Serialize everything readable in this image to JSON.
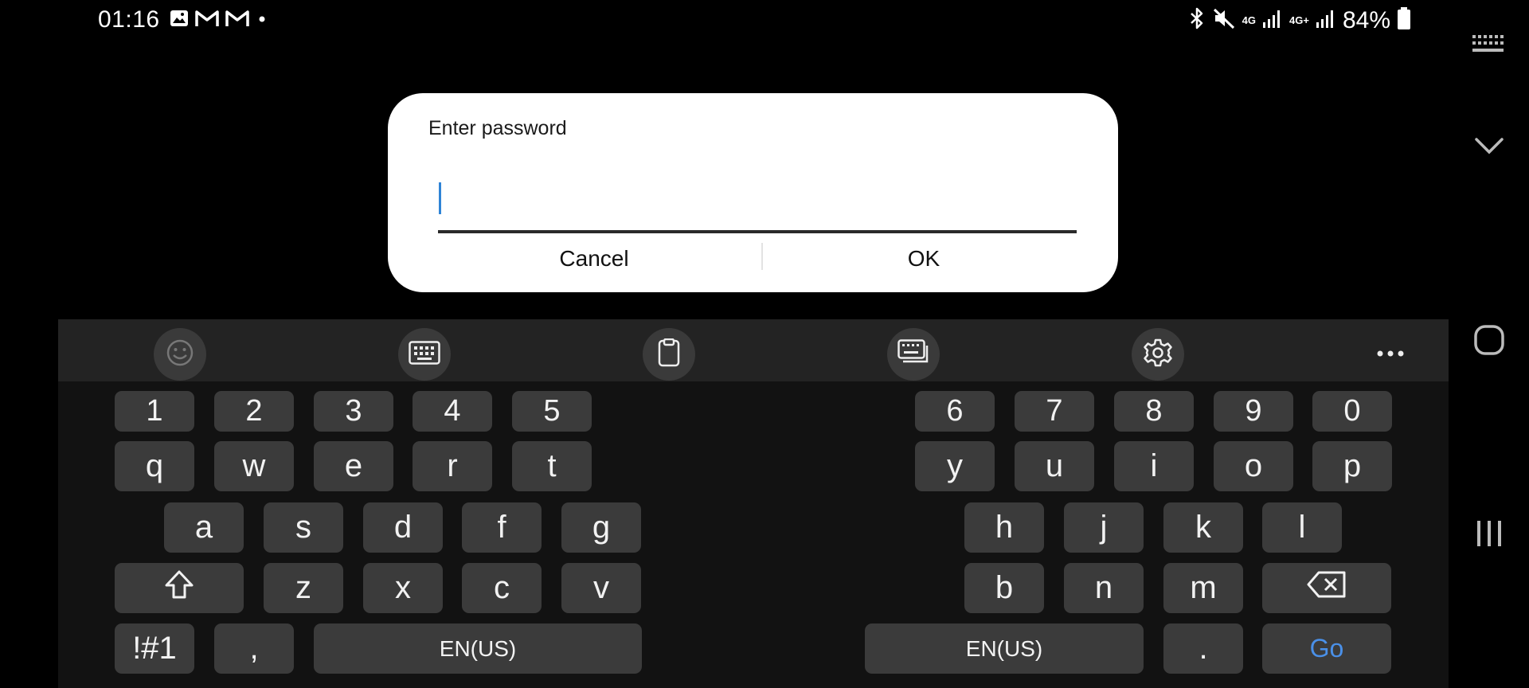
{
  "status_bar": {
    "time": "01:16",
    "left_icons": [
      "gallery-icon",
      "gmail-icon",
      "gmail-icon",
      "dot-icon"
    ],
    "right_icons": [
      "bluetooth-icon",
      "mute-icon",
      "signal-4g-icon",
      "signal-4g-plus-icon",
      "battery-icon"
    ],
    "network_1": "4G",
    "network_2": "4G+",
    "battery": "84%"
  },
  "dialog": {
    "title": "Enter password",
    "input_value": "",
    "cancel_label": "Cancel",
    "ok_label": "OK"
  },
  "keyboard": {
    "toolbar": [
      "emoji-icon",
      "keyboard-icon",
      "clipboard-icon",
      "split-keyboard-icon",
      "settings-icon",
      "more-icon"
    ],
    "number_row": [
      "1",
      "2",
      "3",
      "4",
      "5",
      "6",
      "7",
      "8",
      "9",
      "0"
    ],
    "row1": [
      "q",
      "w",
      "e",
      "r",
      "t",
      "y",
      "u",
      "i",
      "o",
      "p"
    ],
    "row2": [
      "a",
      "s",
      "d",
      "f",
      "g",
      "h",
      "j",
      "k",
      "l"
    ],
    "row3": [
      "z",
      "x",
      "c",
      "v",
      "b",
      "n",
      "m"
    ],
    "symbols_label": "!#1",
    "comma_label": ",",
    "space_left_label": "EN(US)",
    "space_right_label": "EN(US)",
    "period_label": ".",
    "go_label": "Go",
    "accent_color": "#4a90e8"
  },
  "side_nav": [
    "keyboard-toggle-icon",
    "chevron-down-icon",
    "home-icon",
    "recents-icon"
  ]
}
